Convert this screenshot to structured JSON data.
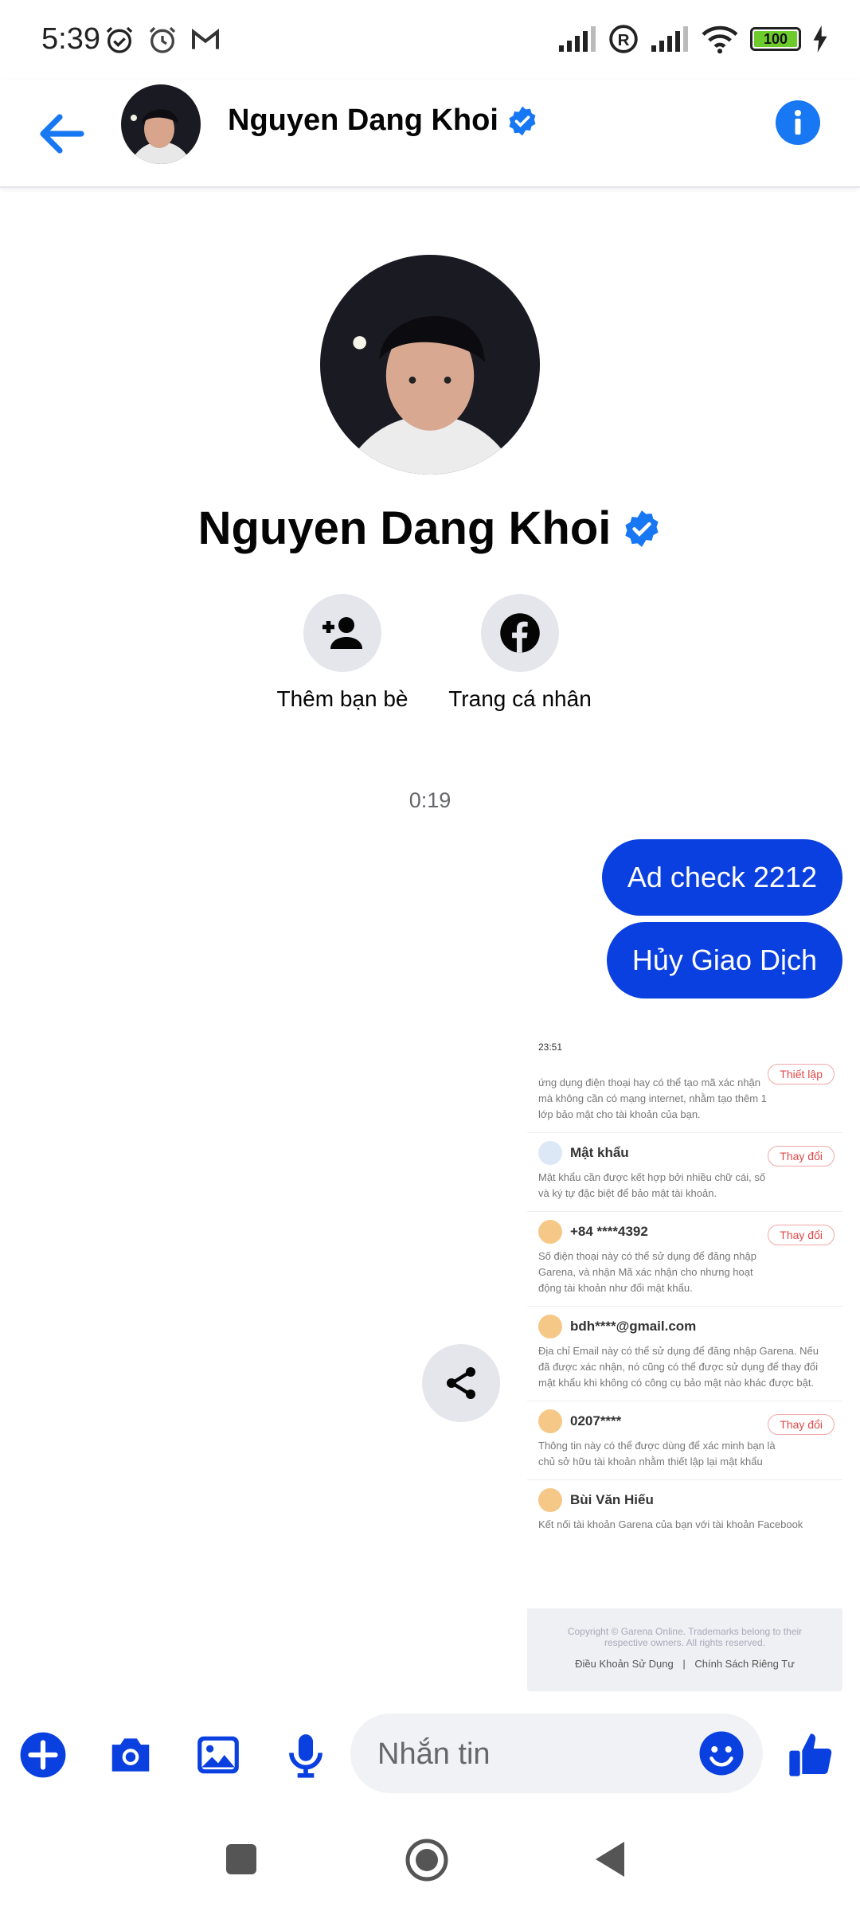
{
  "status_bar": {
    "time": "5:39",
    "battery": "100"
  },
  "header": {
    "name": "Nguyen Dang Khoi"
  },
  "profile": {
    "name": "Nguyen Dang Khoi",
    "actions": [
      {
        "label": "Thêm bạn bè"
      },
      {
        "label": "Trang cá nhân"
      }
    ]
  },
  "conversation": {
    "timestamp": "0:19",
    "messages": [
      {
        "text": "Ad check 2212"
      },
      {
        "text": "Hủy Giao Dịch"
      }
    ],
    "attachment": {
      "status_time": "23:51",
      "items": [
        {
          "title": "",
          "desc": "ứng dụng điện thoại hay có thể tạo mã xác nhận mà không cần có mạng internet, nhằm tạo thêm 1 lớp bảo mật cho tài khoản của bạn.",
          "button": "Thiết lập"
        },
        {
          "title": "Mật khẩu",
          "desc": "Mật khẩu cần được kết hợp bởi nhiều chữ cái, số và ký tự đặc biệt để bảo mật tài khoản.",
          "button": "Thay đổi"
        },
        {
          "title": "+84 ****4392",
          "desc": "Số điện thoại này có thể sử dụng để đăng nhập Garena, và nhận Mã xác nhận cho nhưng hoạt động tài khoản như đổi mật khẩu.",
          "button": "Thay đổi"
        },
        {
          "title": "bdh****@gmail.com",
          "desc": "Địa chỉ Email này có thể sử dụng để đăng nhập Garena. Nếu đã được xác nhận, nó cũng có thể được sử dụng để thay đổi mật khẩu khi không có công cụ bảo mật nào khác được bật.",
          "button": ""
        },
        {
          "title": "0207****",
          "desc": "Thông tin này có thể được dùng để xác minh bạn là chủ sở hữu tài khoản nhằm thiết lập lại mật khẩu",
          "button": "Thay đổi"
        },
        {
          "title": "Bùi Văn Hiếu",
          "desc": "Kết nối tài khoản Garena của bạn với tài khoản Facebook",
          "button": ""
        }
      ],
      "footer_copyright": "Copyright © Garena Online. Trademarks belong to their respective owners. All rights reserved.",
      "footer_link_terms": "Điều Khoản Sử Dụng",
      "footer_sep": "|",
      "footer_link_privacy": "Chính Sách Riêng Tư"
    }
  },
  "composer": {
    "placeholder": "Nhắn tin"
  },
  "colors": {
    "accent": "#1877f2",
    "bubble": "#0a3fe0",
    "composer_icon": "#0a3fe0"
  }
}
